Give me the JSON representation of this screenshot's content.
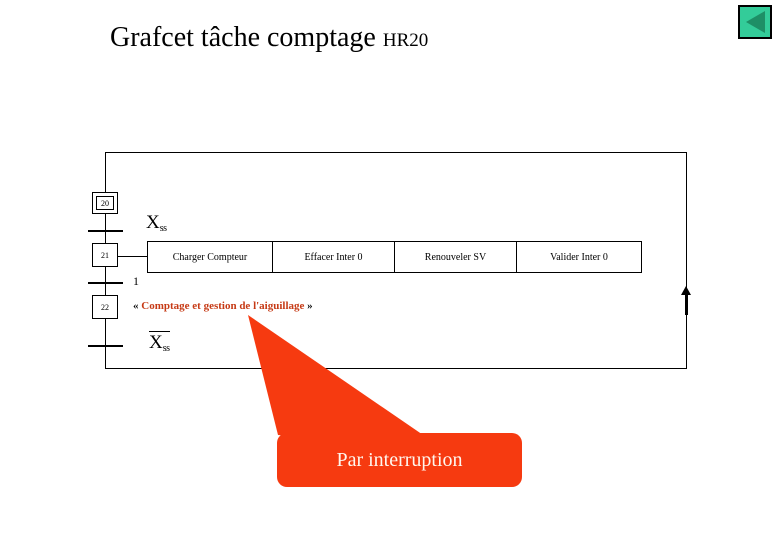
{
  "slide": {
    "title_main": "Grafcet tâche comptage",
    "title_suffix": "HR20",
    "background_color": "#FFFFFF"
  },
  "nav": {
    "back_button_icon": "left-triangle-icon",
    "back_button_face_color": "#33CC99",
    "back_button_triangle_color": "#1E8F66"
  },
  "grafcet": {
    "steps": [
      {
        "number": "20",
        "type": "initial"
      },
      {
        "number": "21",
        "type": "normal"
      },
      {
        "number": "22",
        "type": "normal"
      }
    ],
    "transitions": [
      {
        "id": "t20",
        "condition_var": "X",
        "condition_sub": "ss",
        "negated": false,
        "label": "Xss"
      },
      {
        "id": "t21",
        "condition_var": "1",
        "negated": false,
        "label": "1"
      },
      {
        "id": "t22",
        "condition_var": "X",
        "condition_sub": "ss",
        "negated": true,
        "label": "Xss (barré)"
      }
    ],
    "actions": [
      {
        "label": "Charger Compteur"
      },
      {
        "label": "Effacer Inter 0"
      },
      {
        "label": "Renouveler SV"
      },
      {
        "label": "Valider Inter 0"
      }
    ],
    "annotation": {
      "open_guillemet": "«",
      "text": "Comptage et gestion de l'aiguillage",
      "close_guillemet": "»",
      "color": "#C63A15"
    }
  },
  "callout": {
    "label": "Par interruption",
    "fill_color": "#F63A10",
    "text_color": "#FFF6EE"
  }
}
